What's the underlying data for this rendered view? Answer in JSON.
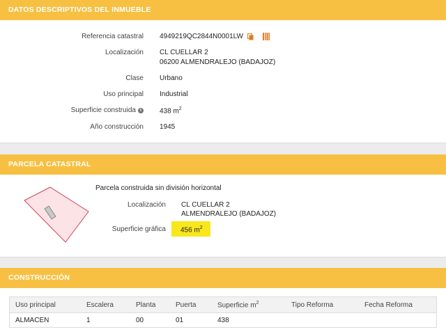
{
  "datos": {
    "title": "DATOS DESCRIPTIVOS DEL INMUEBLE",
    "ref_label": "Referencia catastral",
    "ref_value": "4949219QC2844N0001LW",
    "loc_label": "Localización",
    "loc_line1": "CL CUELLAR 2",
    "loc_line2": "06200 ALMENDRALEJO (BADAJOZ)",
    "clase_label": "Clase",
    "clase_value": "Urbano",
    "uso_label": "Uso principal",
    "uso_value": "Industrial",
    "sup_label": "Superficie construida",
    "sup_value": "438 m",
    "sup_unit_exp": "2",
    "anio_label": "Año construcción",
    "anio_value": "1945"
  },
  "parcela": {
    "title": "PARCELA CATASTRAL",
    "subtitle": "Parcela construida sin división horizontal",
    "loc_label": "Localización",
    "loc_line1": "CL CUELLAR 2",
    "loc_line2": "ALMENDRALEJO (BADAJOZ)",
    "sup_label": "Superficie gráfica",
    "sup_value": "456 m",
    "sup_unit_exp": "2"
  },
  "construccion": {
    "title": "CONSTRUCCIÓN",
    "columns": [
      "Uso principal",
      "Escalera",
      "Planta",
      "Puerta",
      "Superficie m",
      "Tipo Reforma",
      "Fecha Reforma"
    ],
    "sup_col_exp": "2",
    "rows": [
      [
        "ALMACEN",
        "1",
        "00",
        "01",
        "438",
        "",
        ""
      ]
    ]
  },
  "colors": {
    "header": "#f7c042",
    "highlight": "#f8e71c",
    "parcel_fill": "#fbe3e6",
    "parcel_stroke": "#d0455f",
    "building_fill": "#c8c8c8"
  }
}
